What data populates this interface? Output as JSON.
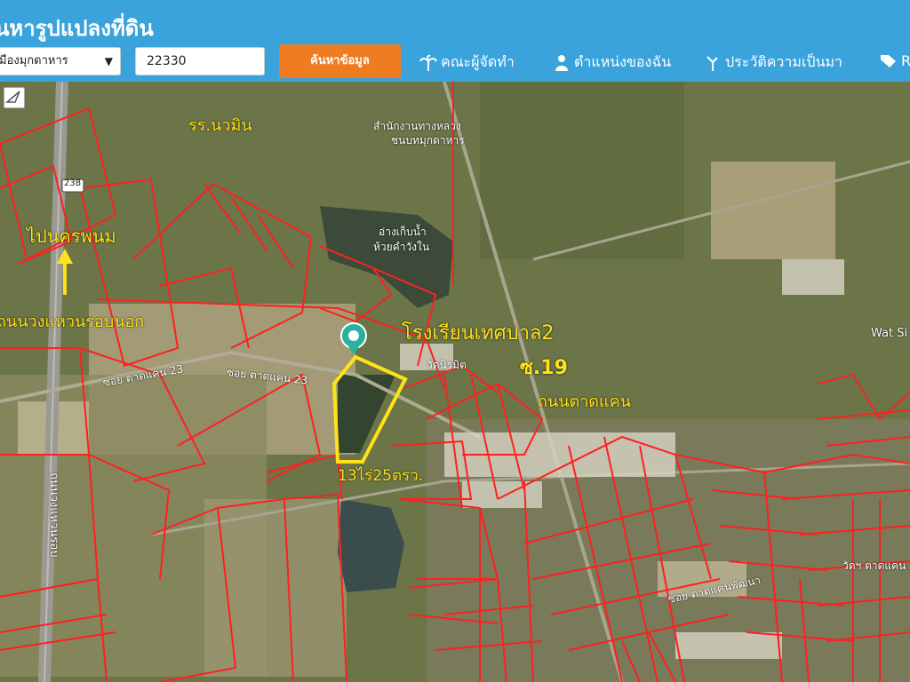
{
  "header": {
    "title": "นหารูปแปลงที่ดิน",
    "province_value": "มืองมุกดาหาร",
    "postal_value": "22330",
    "search_label": "ค้นหาข้อมูล",
    "nav": [
      {
        "label": "คณะผู้จัดทำ",
        "icon": "palm-tree-icon"
      },
      {
        "label": "ตำแหน่งของฉัน",
        "icon": "person-icon"
      },
      {
        "label": "ประวัติความเป็นมา",
        "icon": "tree-icon"
      },
      {
        "label": "R",
        "icon": "tag-icon"
      }
    ]
  },
  "map": {
    "labels": {
      "school_top": "รร.นวมิน",
      "highway_office_1": "สำนักงานทางหลวง",
      "highway_office_2": "ชนบทมุกดาหาร",
      "reservoir_1": "อ่างเก็บน้ำ",
      "reservoir_2": "ห้วยคำวังใน",
      "route_badge": "238",
      "to_nakhon_phanom": "ไปนครพนม",
      "ring_road": "ถนนวงแหวนรอบนอก",
      "municipal_school": "โรงเรียนเทศบาล2",
      "wat": "วัดนิรมิต",
      "soi": "ซ.19",
      "road_name": "ถนนตาดแคน",
      "soi_23_a": "ซอย ตาดแคน 23",
      "soi_23_b": "ซอย ตาดแคน 23",
      "plot_size": "13ไร่25ตรว.",
      "vertical_road": "ถนนวงแหวนรอบ",
      "wat_right": "Wat Si",
      "wat_bottom_right": "วัดฯ ตาดแคน",
      "road_bottom": "ซอย ตาดแคนพัฒนา"
    },
    "colors": {
      "parcel": "#ff2020",
      "highlight": "#ffe21a",
      "header": "#3aa3dc",
      "button": "#ef7c21"
    }
  }
}
